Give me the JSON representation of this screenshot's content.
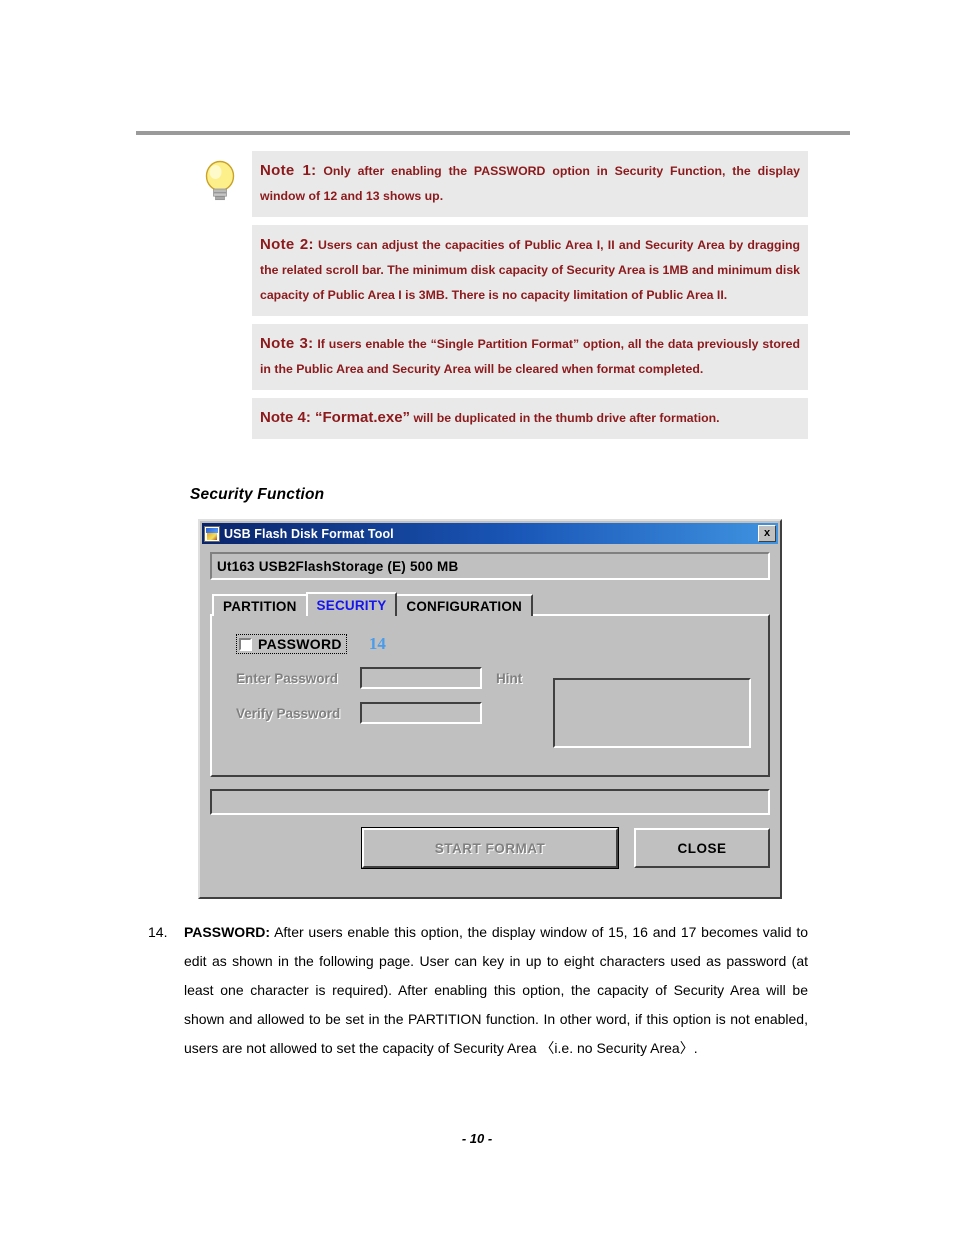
{
  "page": {
    "footer": "- 10 -",
    "heading": "Security Function"
  },
  "notes": {
    "icon": "lightbulb-icon",
    "items": [
      {
        "lead": "Note 1:",
        "text": " Only after enabling the PASSWORD option in Security Function, the display window of 12 and 13 shows up."
      },
      {
        "lead": "Note 2:",
        "text": " Users can adjust the capacities of Public Area I, II and Security Area by dragging the related scroll bar. The minimum disk capacity of Security Area is 1MB and minimum disk capacity of Public Area I is 3MB. There is no capacity limitation of Public Area II."
      },
      {
        "lead": "Note 3:",
        "text": " If users enable the “Single Partition Format” option, all the data previously stored in the Public Area and Security Area will be cleared when format completed."
      },
      {
        "lead": "Note 4: “Format.exe”",
        "text": " will be duplicated in the thumb drive after formation."
      }
    ]
  },
  "dialog": {
    "title": "USB Flash Disk Format Tool",
    "title_icon": "app-icon",
    "close_icon": "✕",
    "close_label": "x",
    "device_info": "Ut163    USB2FlashStorage (E)  500 MB",
    "tabs": [
      {
        "label": "PARTITION",
        "active": false
      },
      {
        "label": "SECURITY",
        "active": true
      },
      {
        "label": "CONFIGURATION",
        "active": false
      }
    ],
    "security_panel": {
      "password_checkbox_label": "PASSWORD",
      "password_checked": false,
      "callout": "14",
      "enter_password_label": "Enter Password",
      "enter_password_value": "",
      "verify_password_label": "Verify Password",
      "verify_password_value": "",
      "hint_label": "Hint",
      "hint_value": ""
    },
    "progress_value": "",
    "buttons": {
      "start_format": "START FORMAT",
      "start_format_disabled": true,
      "close": "CLOSE"
    },
    "colors": {
      "face": "#c0c0c0",
      "titlebar_start": "#0a246a",
      "titlebar_end": "#3f93e0",
      "active_tab_text": "#1515ee",
      "callout": "#4a9ceb",
      "disabled_text": "#808080"
    }
  },
  "body_text": {
    "number": "14.",
    "lead": "PASSWORD:",
    "paragraph": " After users enable this option, the display window of 15, 16 and 17 becomes valid to edit as shown in the following page. User can key in up to eight characters used as password (at least one character is required). After enabling this option, the capacity of Security Area will be shown and allowed to be set in the PARTITION function. In other word, if this option is not enabled, users are not allowed to set the capacity of Security Area 〈i.e. no Security Area〉."
  }
}
